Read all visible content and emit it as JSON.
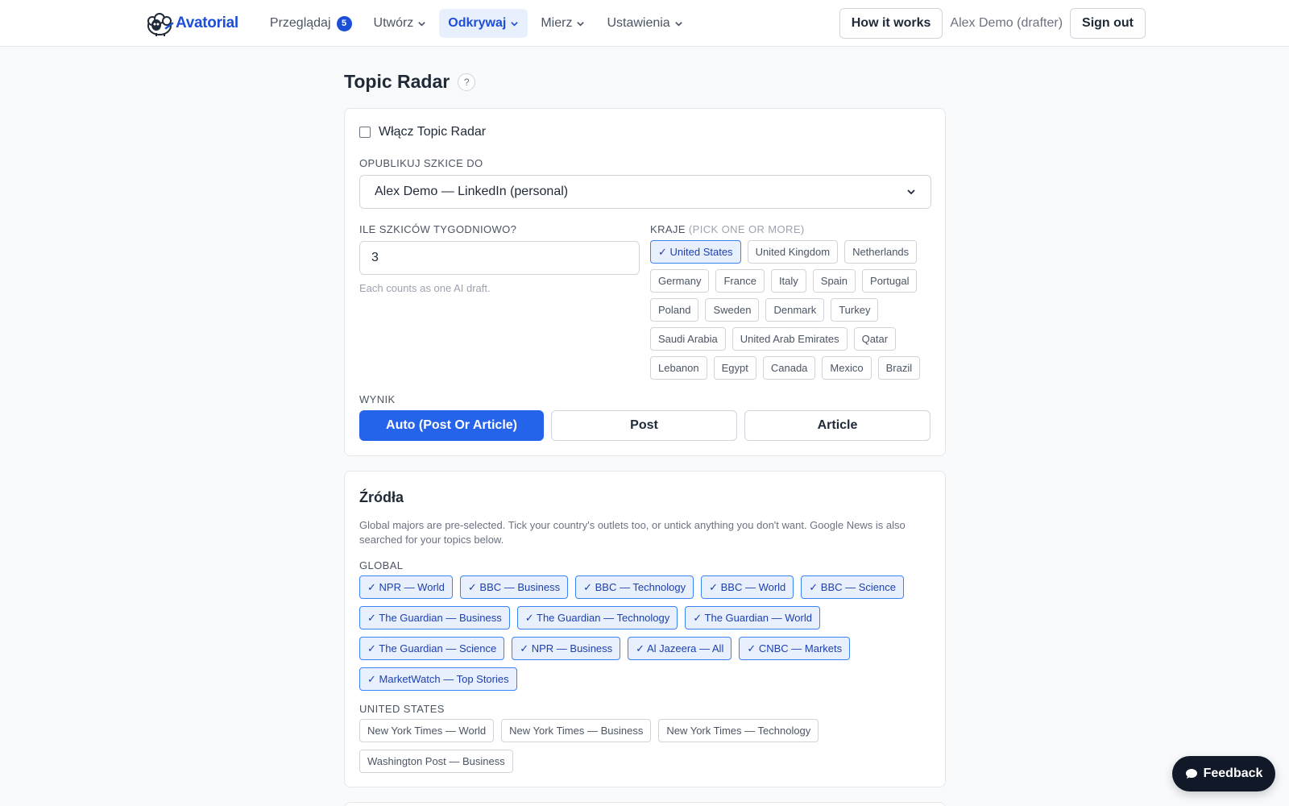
{
  "nav": {
    "logo_text": "Avatorial",
    "items": [
      {
        "label": "Przeglądaj",
        "badge": "5"
      },
      {
        "label": "Utwórz"
      },
      {
        "label": "Odkrywaj"
      },
      {
        "label": "Mierz"
      },
      {
        "label": "Ustawienia"
      }
    ],
    "how_it_works": "How it works",
    "user": "Alex Demo (drafter)",
    "sign_out": "Sign out"
  },
  "page": {
    "title": "Topic Radar",
    "help": "?"
  },
  "settings": {
    "enable_label": "Włącz Topic Radar",
    "enabled": false,
    "publish_label": "OPUBLIKUJ SZKICE DO",
    "publish_value": "Alex Demo — LinkedIn (personal)",
    "count_label": "ILE SZKICÓW TYGODNIOWO?",
    "count_value": "3",
    "count_hint": "Each counts as one AI draft.",
    "countries_label": "KRAJE",
    "countries_hint": "(PICK ONE OR MORE)",
    "countries": [
      {
        "label": "✓ United States",
        "selected": true
      },
      {
        "label": "United Kingdom",
        "selected": false
      },
      {
        "label": "Netherlands",
        "selected": false
      },
      {
        "label": "Germany",
        "selected": false
      },
      {
        "label": "France",
        "selected": false
      },
      {
        "label": "Italy",
        "selected": false
      },
      {
        "label": "Spain",
        "selected": false
      },
      {
        "label": "Portugal",
        "selected": false
      },
      {
        "label": "Poland",
        "selected": false
      },
      {
        "label": "Sweden",
        "selected": false
      },
      {
        "label": "Denmark",
        "selected": false
      },
      {
        "label": "Turkey",
        "selected": false
      },
      {
        "label": "Saudi Arabia",
        "selected": false
      },
      {
        "label": "United Arab Emirates",
        "selected": false
      },
      {
        "label": "Qatar",
        "selected": false
      },
      {
        "label": "Lebanon",
        "selected": false
      },
      {
        "label": "Egypt",
        "selected": false
      },
      {
        "label": "Canada",
        "selected": false
      },
      {
        "label": "Mexico",
        "selected": false
      },
      {
        "label": "Brazil",
        "selected": false
      }
    ],
    "result_label": "WYNIK",
    "result_options": [
      {
        "label": "Auto (Post Or Article)",
        "active": true
      },
      {
        "label": "Post",
        "active": false
      },
      {
        "label": "Article",
        "active": false
      }
    ]
  },
  "sources": {
    "title": "Źródła",
    "description": "Global majors are pre-selected. Tick your country's outlets too, or untick anything you don't want. Google News is also searched for your topics below.",
    "global_label": "GLOBAL",
    "global": [
      {
        "label": "✓ NPR — World",
        "selected": true
      },
      {
        "label": "✓ BBC — Business",
        "selected": true
      },
      {
        "label": "✓ BBC — Technology",
        "selected": true
      },
      {
        "label": "✓ BBC — World",
        "selected": true
      },
      {
        "label": "✓ BBC — Science",
        "selected": true
      },
      {
        "label": "✓ The Guardian — Business",
        "selected": true
      },
      {
        "label": "✓ The Guardian — Technology",
        "selected": true
      },
      {
        "label": "✓ The Guardian — World",
        "selected": true
      },
      {
        "label": "✓ The Guardian — Science",
        "selected": true
      },
      {
        "label": "✓ NPR — Business",
        "selected": true
      },
      {
        "label": "✓ Al Jazeera — All",
        "selected": true
      },
      {
        "label": "✓ CNBC — Markets",
        "selected": true
      },
      {
        "label": "✓ MarketWatch — Top Stories",
        "selected": true
      }
    ],
    "us_label": "UNITED STATES",
    "us": [
      {
        "label": "New York Times — World",
        "selected": false
      },
      {
        "label": "New York Times — Business",
        "selected": false
      },
      {
        "label": "New York Times — Technology",
        "selected": false
      },
      {
        "label": "Washington Post — Business",
        "selected": false
      }
    ]
  },
  "feedback": {
    "label": "Feedback"
  },
  "colors": {
    "accent": "#2563eb",
    "nav_active_bg": "#e8f0fe",
    "chip_selected_border": "#3b82f6"
  }
}
